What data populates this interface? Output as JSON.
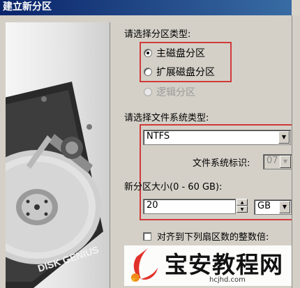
{
  "window": {
    "title": "建立新分区"
  },
  "brand": {
    "disk_logo": "DISK GENIUS"
  },
  "partition_type": {
    "label": "请选择分区类型:",
    "options": [
      {
        "label": "主磁盘分区",
        "selected": true,
        "enabled": true
      },
      {
        "label": "扩展磁盘分区",
        "selected": false,
        "enabled": true
      },
      {
        "label": "逻辑分区",
        "selected": false,
        "enabled": false
      }
    ]
  },
  "filesystem": {
    "label": "请选择文件系统类型:",
    "value": "NTFS",
    "id_label": "文件系统标识:",
    "id_value": "07"
  },
  "size": {
    "label": "新分区大小(0 - 60 GB):",
    "value": "20",
    "unit": "GB"
  },
  "align": {
    "label": "对齐到下列扇区数的整数倍:"
  },
  "watermark": {
    "text": "宝安教程网",
    "url": "hcjhd.com"
  },
  "colors": {
    "highlight": "#d03a3a",
    "title_bar": "#0a246a"
  }
}
